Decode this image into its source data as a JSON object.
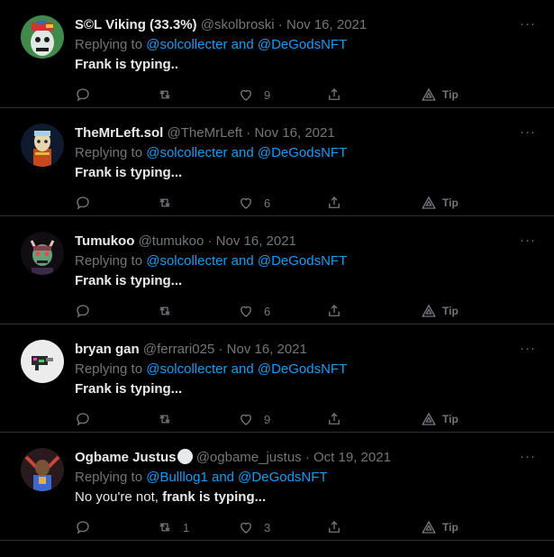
{
  "tweets": [
    {
      "name": "S©L Viking (33.3%)",
      "handle": "@skolbroski",
      "sep": "·",
      "date": "Nov 16, 2021",
      "replying_prefix": "Replying to ",
      "mentions": "@solcollecter and @DeGodsNFT",
      "text_plain": "",
      "text_bold": "Frank is typing..",
      "more": "···",
      "reply_count": "",
      "retweet_count": "",
      "like_count": "9",
      "tip_label": "Tip",
      "avatar_color": "#3f8a4a"
    },
    {
      "name": "TheMrLeft.sol",
      "handle": "@TheMrLeft",
      "sep": "·",
      "date": "Nov 16, 2021",
      "replying_prefix": "Replying to ",
      "mentions": "@solcollecter and @DeGodsNFT",
      "text_plain": "",
      "text_bold": "Frank is typing...",
      "more": "···",
      "reply_count": "",
      "retweet_count": "",
      "like_count": "6",
      "tip_label": "Tip",
      "avatar_color": "#0f1a2e"
    },
    {
      "name": "Tumukoo",
      "handle": "@tumukoo",
      "sep": "·",
      "date": "Nov 16, 2021",
      "replying_prefix": "Replying to ",
      "mentions": "@solcollecter and @DeGodsNFT",
      "text_plain": "",
      "text_bold": "Frank is typing...",
      "more": "···",
      "reply_count": "",
      "retweet_count": "",
      "like_count": "6",
      "tip_label": "Tip",
      "avatar_color": "#120d10"
    },
    {
      "name": "bryan gan",
      "handle": "@ferrari025",
      "sep": "·",
      "date": "Nov 16, 2021",
      "replying_prefix": "Replying to ",
      "mentions": "@solcollecter and @DeGodsNFT",
      "text_plain": "",
      "text_bold": "Frank is typing...",
      "more": "···",
      "reply_count": "",
      "retweet_count": "",
      "like_count": "9",
      "tip_label": "Tip",
      "avatar_color": "#ececec"
    },
    {
      "name": "Ogbame Justus",
      "handle": "@ogbame_justus",
      "sep": "·",
      "date": "Oct 19, 2021",
      "replying_prefix": "Replying to ",
      "mentions": "@Bulllog1 and @DeGodsNFT",
      "text_plain": "No you're not, ",
      "text_bold": "frank is typing...",
      "more": "···",
      "reply_count": "",
      "retweet_count": "1",
      "like_count": "3",
      "tip_label": "Tip",
      "avatar_color": "#2a1a1e"
    }
  ]
}
